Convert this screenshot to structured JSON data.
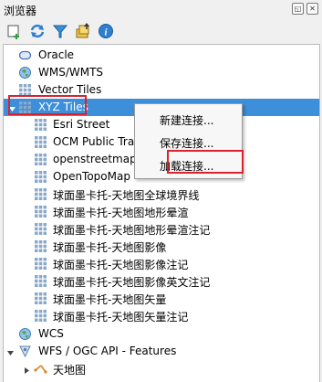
{
  "window": {
    "title": "浏览器",
    "float_btn": "◱",
    "close_btn": "✕"
  },
  "toolbar": {
    "tools": [
      "add-layer-icon",
      "refresh-icon",
      "filter-icon",
      "collapse-all-icon",
      "info-icon"
    ]
  },
  "tree": {
    "items": [
      {
        "label": "Oracle",
        "icon": "oracle-icon"
      },
      {
        "label": "WMS/WMTS",
        "icon": "globe-icon"
      },
      {
        "label": "Vector Tiles",
        "icon": "grid-icon"
      },
      {
        "label": "XYZ Tiles",
        "icon": "grid-icon",
        "expanded": true,
        "selected": true
      },
      {
        "label": "Esri Street",
        "icon": "grid-icon"
      },
      {
        "label": "OCM Public Tra",
        "icon": "grid-icon"
      },
      {
        "label": "openstreetmap",
        "icon": "grid-icon"
      },
      {
        "label": "OpenTopoMap",
        "icon": "grid-icon"
      },
      {
        "label": "球面墨卡托-天地图全球境界线",
        "icon": "grid-icon"
      },
      {
        "label": "球面墨卡托-天地图地形晕渲",
        "icon": "grid-icon"
      },
      {
        "label": "球面墨卡托-天地图地形晕渲注记",
        "icon": "grid-icon"
      },
      {
        "label": "球面墨卡托-天地图影像",
        "icon": "grid-icon"
      },
      {
        "label": "球面墨卡托-天地图影像注记",
        "icon": "grid-icon"
      },
      {
        "label": "球面墨卡托-天地图影像英文注记",
        "icon": "grid-icon"
      },
      {
        "label": "球面墨卡托-天地图矢量",
        "icon": "grid-icon"
      },
      {
        "label": "球面墨卡托-天地图矢量注记",
        "icon": "grid-icon"
      },
      {
        "label": "WCS",
        "icon": "globe-icon"
      },
      {
        "label": "WFS / OGC API - Features",
        "icon": "wfs-icon",
        "expanded": true
      },
      {
        "label": "天地图",
        "icon": "vector-icon"
      }
    ]
  },
  "context_menu": {
    "items": [
      "新建连接...",
      "保存连接...",
      "加载连接..."
    ],
    "highlighted_index": 2
  },
  "colors": {
    "selection": "#3c8fd8",
    "highlight_frame": "#d9242e"
  }
}
